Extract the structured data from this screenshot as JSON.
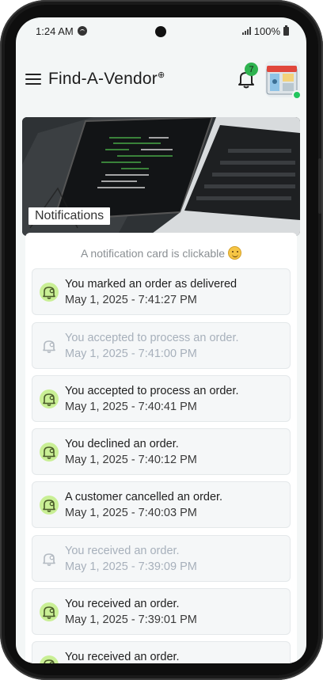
{
  "status_bar": {
    "time": "1:24 AM",
    "battery": "100%"
  },
  "header": {
    "app_title": "Find-A-Vendor",
    "title_mark": "⊕",
    "notification_count": "7"
  },
  "hero": {
    "label": "Notifications"
  },
  "hint": {
    "text": "A notification card is clickable"
  },
  "colors": {
    "accent_green": "#2fb350",
    "icon_bg_unread": "#c9ef95",
    "read_text": "#a7b0bb"
  },
  "notifications": [
    {
      "title": "You marked an order as delivered",
      "time": "May 1, 2025 - 7:41:27 PM",
      "read": false
    },
    {
      "title": "You accepted to process an order.",
      "time": "May 1, 2025 - 7:41:00 PM",
      "read": true
    },
    {
      "title": "You accepted to process an order.",
      "time": "May 1, 2025 - 7:40:41 PM",
      "read": false
    },
    {
      "title": "You declined an order.",
      "time": "May 1, 2025 - 7:40:12 PM",
      "read": false
    },
    {
      "title": "A customer cancelled an order.",
      "time": "May 1, 2025 - 7:40:03 PM",
      "read": false
    },
    {
      "title": "You received an order.",
      "time": "May 1, 2025 - 7:39:09 PM",
      "read": true
    },
    {
      "title": "You received an order.",
      "time": "May 1, 2025 - 7:39:01 PM",
      "read": false
    },
    {
      "title": "You received an order.",
      "time": "",
      "read": false
    }
  ]
}
